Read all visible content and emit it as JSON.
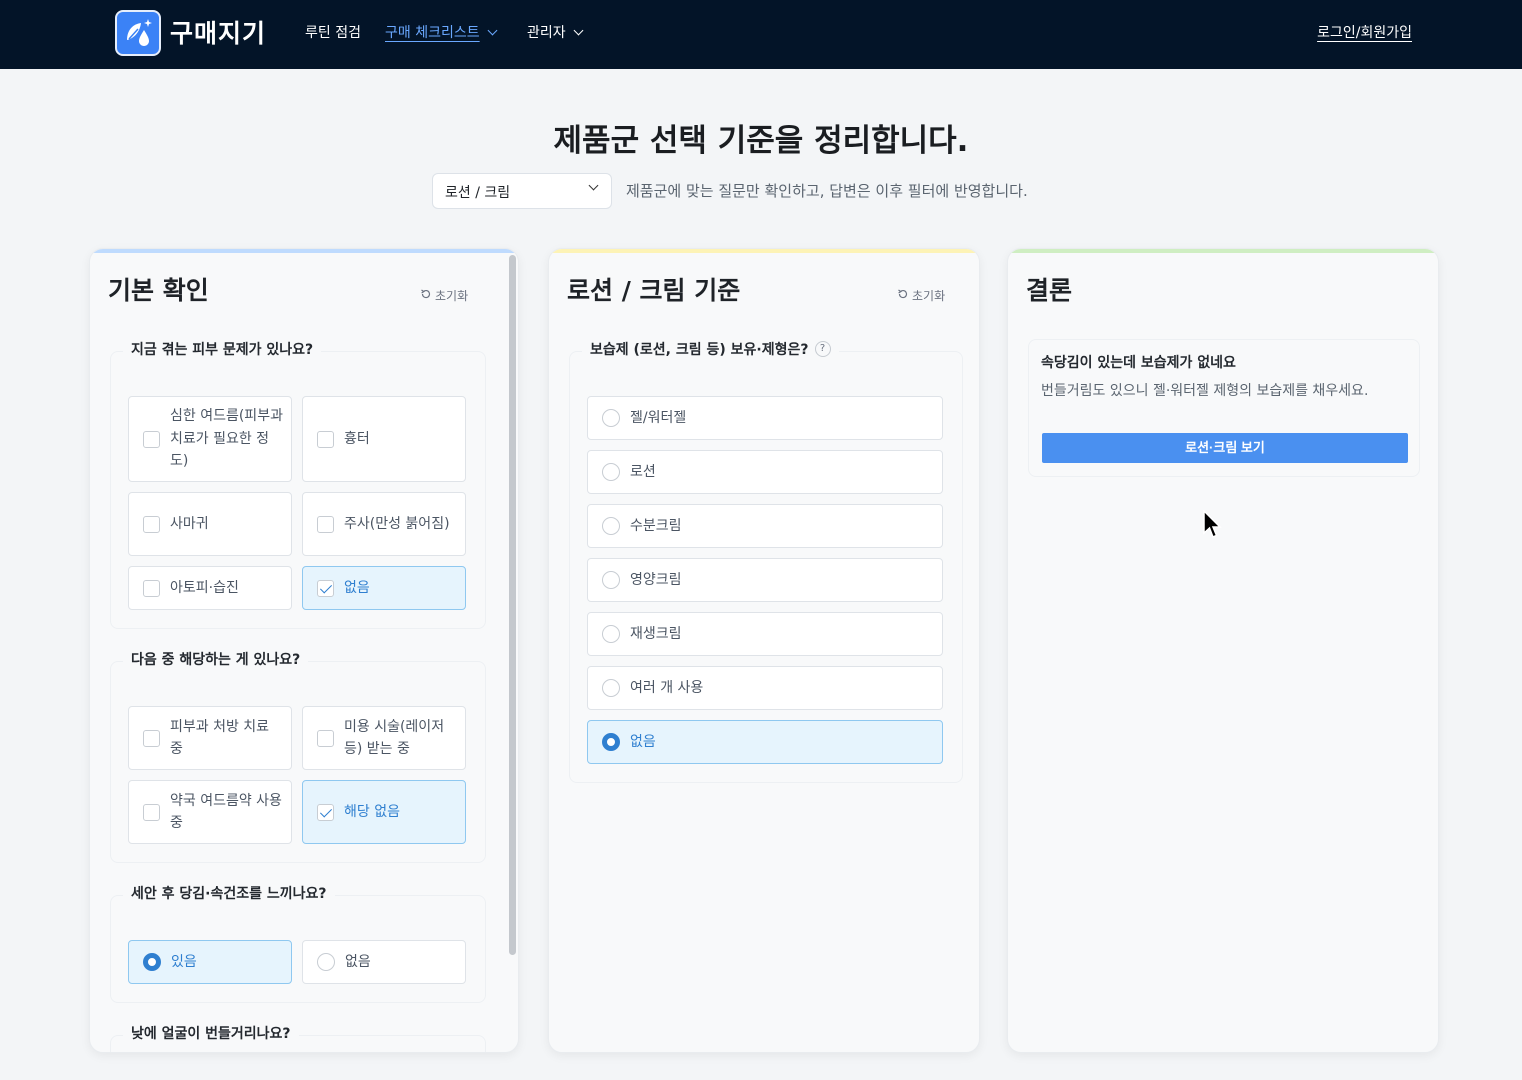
{
  "header": {
    "brand": "구매지기",
    "nav": [
      {
        "label": "루틴 점검",
        "active": false,
        "dropdown": false
      },
      {
        "label": "구매 체크리스트",
        "active": true,
        "dropdown": true
      },
      {
        "label": "관리자",
        "active": false,
        "dropdown": true
      }
    ],
    "login": "로그인/회원가입"
  },
  "hero": {
    "title": "제품군 선택 기준을 정리합니다.",
    "select_value": "로션 / 크림",
    "description": "제품군에 맞는 질문만 확인하고, 답변은 이후 필터에 반영합니다."
  },
  "basic": {
    "title": "기본 확인",
    "reset": "초기화",
    "q1": {
      "legend": "지금 겪는 피부 문제가 있나요?",
      "options": [
        "심한 여드름(피부과 치료가 필요한 정도)",
        "흉터",
        "사마귀",
        "주사(만성 붉어짐)",
        "아토피·습진",
        "없음"
      ],
      "selected": "없음"
    },
    "q2": {
      "legend": "다음 중 해당하는 게 있나요?",
      "options": [
        "피부과 처방 치료 중",
        "미용 시술(레이저 등) 받는 중",
        "약국 여드름약 사용 중",
        "해당 없음"
      ],
      "selected": "해당 없음"
    },
    "q3": {
      "legend": "세안 후 당김·속건조를 느끼나요?",
      "options": [
        "있음",
        "없음"
      ],
      "selected": "있음"
    },
    "q4": {
      "legend": "낮에 얼굴이 번들거리나요?"
    }
  },
  "lotion": {
    "title": "로션 / 크림 기준",
    "reset": "초기화",
    "q1": {
      "legend": "보습제 (로션, 크림 등) 보유·제형은?",
      "help": "?",
      "options": [
        "젤/워터젤",
        "로션",
        "수분크림",
        "영양크림",
        "재생크림",
        "여러 개 사용",
        "없음"
      ],
      "selected": "없음"
    }
  },
  "conclusion": {
    "title": "결론",
    "card_title": "속당김이 있는데 보습제가 없네요",
    "card_desc": "번들거림도 있으니 젤·워터젤 제형의 보습제를 채우세요.",
    "button": "로션·크림 보기"
  },
  "colors": {
    "header_bg": "#031428",
    "accent": "#2f7fd0",
    "button": "#4a90f0"
  }
}
